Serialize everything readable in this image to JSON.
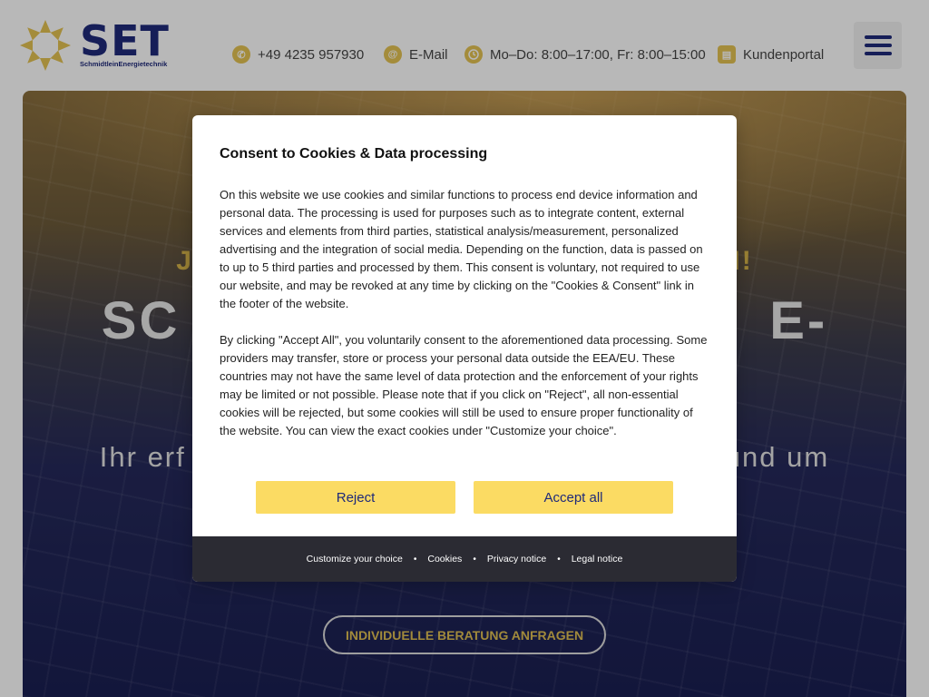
{
  "header": {
    "logo": {
      "text": "SET",
      "subtitle": "SchmidtleinEnergietechnik",
      "icon": "sun-logo-icon"
    },
    "contact": {
      "phone": "+49 4235 957930",
      "email": "E-Mail",
      "hours": "Mo–Do: 8:00–17:00, Fr: 8:00–15:00",
      "portal": "Kundenportal"
    },
    "menu_icon": "hamburger-menu-icon"
  },
  "hero": {
    "pre_heading": "JET                                                  EN!",
    "title": "SC                                  E-",
    "description": "Ihr erf                                                    n rund um                                                   ngig, nachho                                                   eigenen",
    "cta_label": "INDIVIDUELLE BERATUNG ANFRAGEN"
  },
  "consent": {
    "title": "Consent to Cookies & Data processing",
    "paragraph1": "On this website we use cookies and similar functions to process end device information and personal data. The processing is used for purposes such as to integrate content, external services and elements from third parties, statistical analysis/measurement, personalized advertising and the integration of social media. Depending on the function, data is passed on to up to 5 third parties and processed by them. This consent is voluntary, not required to use our website, and may be revoked at any time by clicking on the \"Cookies & Consent\" link in the footer of the website.",
    "paragraph2": "By clicking \"Accept All\", you voluntarily consent to the aforementioned data processing. Some providers may transfer, store or process your personal data outside the EEA/EU. These countries may not have the same level of data protection and the enforcement of your rights may be limited or not possible. Please note that if you click on \"Reject\", all non-essential cookies will be rejected, but some cookies will still be used to ensure proper functionality of the website. You can view the exact cookies under \"Customize your choice\".",
    "reject_label": "Reject",
    "accept_label": "Accept all",
    "footer_links": [
      "Customize your choice",
      "Cookies",
      "Privacy notice",
      "Legal notice"
    ],
    "separator": "•"
  },
  "colors": {
    "brand_blue": "#1f2a7a",
    "brand_yellow": "#e3c253",
    "button_yellow": "#fbdb63",
    "footer_dark": "#2b2b33"
  }
}
